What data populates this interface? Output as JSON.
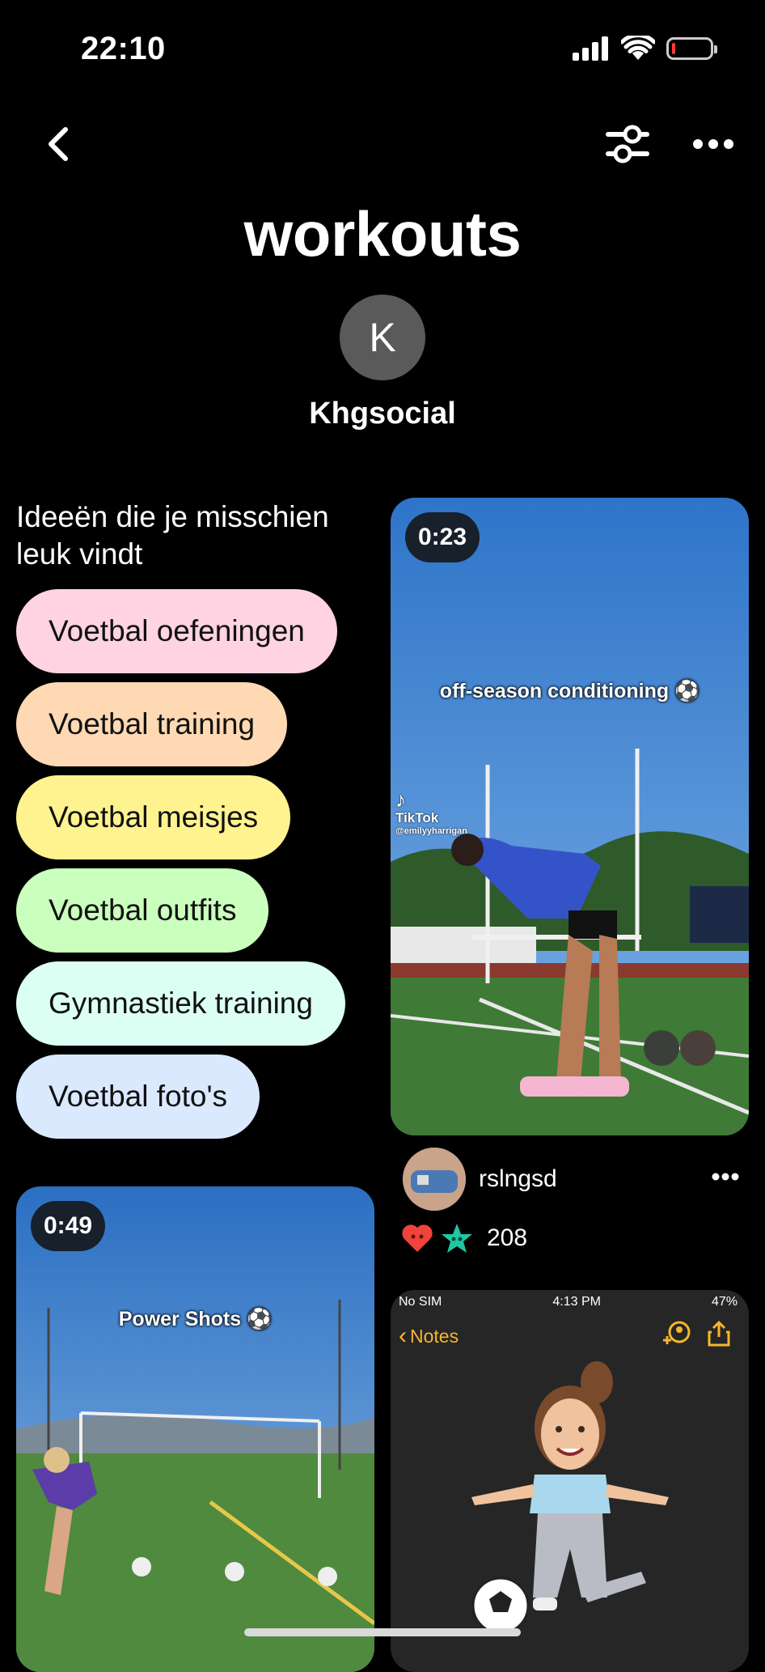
{
  "status_bar": {
    "time": "22:10"
  },
  "header": {
    "title": "workouts",
    "owner_initial": "K",
    "owner_name": "Khgsocial"
  },
  "ideas": {
    "heading_line1": "Ideeën die je misschien",
    "heading_line2": "leuk vindt",
    "chips": [
      {
        "label": "Voetbal oefeningen",
        "color": "#ffd3e1"
      },
      {
        "label": "Voetbal training",
        "color": "#ffd9b3"
      },
      {
        "label": "Voetbal meisjes",
        "color": "#fff38f"
      },
      {
        "label": "Voetbal outfits",
        "color": "#caffbd"
      },
      {
        "label": "Gymnastiek training",
        "color": "#dcfff4"
      },
      {
        "label": "Voetbal foto's",
        "color": "#dbe9ff"
      }
    ]
  },
  "pins": [
    {
      "duration": "0:23",
      "overlay": "off-season conditioning ⚽",
      "watermark_brand": "TikTok",
      "watermark_handle": "@emilyyharrigan",
      "user": "rslngsd",
      "reaction_count": "208"
    },
    {
      "duration": "0:49",
      "overlay": "Power Shots ⚽"
    },
    {
      "phone_status": {
        "carrier": "No SIM",
        "time": "4:13 PM",
        "battery": "47%"
      },
      "back_label": "Notes"
    }
  ]
}
